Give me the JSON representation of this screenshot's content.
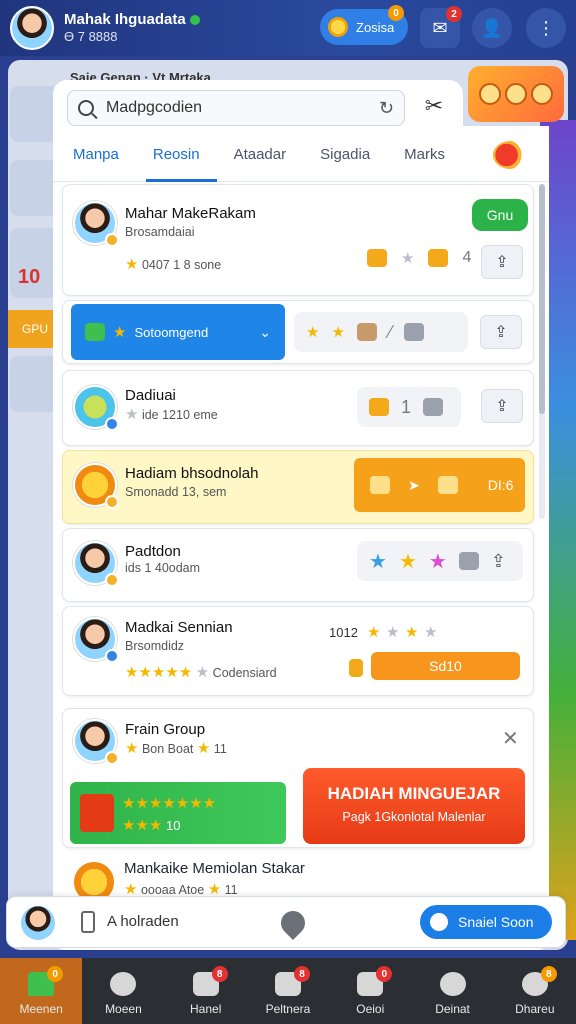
{
  "topbar": {
    "name": "Mahak Ihguadata",
    "id": "Ө 7 8888",
    "coin_label": "Zosisa",
    "coin_badge": "0",
    "inbox_badge": "2"
  },
  "background": {
    "title": "Saie Genan  ·  Vt   Mrtaka",
    "gpu_label": "GPU",
    "left_number": "10"
  },
  "search": {
    "value": "Madpgcodien"
  },
  "tabs": [
    {
      "label": "Manpa"
    },
    {
      "label": "Reosin",
      "active": true
    },
    {
      "label": "Ataadar"
    },
    {
      "label": "Sigadia"
    },
    {
      "label": "Marks"
    }
  ],
  "cards": {
    "c1": {
      "name": "Mahar MakeRakam",
      "sub": "Brosamdaiai",
      "meta": "0407 1 8 sone",
      "button": "Gnu"
    },
    "c2": {
      "select": "Sotoomgend"
    },
    "c3": {
      "name": "Dadiuai",
      "meta": "ide 1210 eme"
    },
    "c4": {
      "name": "Hadiam bhsodnolah",
      "sub": "Smonadd 13, sem",
      "button": "DI:6"
    },
    "c5": {
      "name": "Padtdon",
      "sub": "ids 1 40odam"
    },
    "c6": {
      "name": "Madkai Sennian",
      "sub": "Brsomdidz",
      "score": "1012",
      "meta": "Codensiard",
      "button": "Sd10"
    },
    "c7": {
      "name": "Frain Group",
      "meta": "Bon   Boat",
      "count": "11",
      "promo_count": "10",
      "promo_title": "HADIAH MINGUEJAR",
      "promo_sub": "Pagk 1Gkonlotal Malenlar"
    },
    "c8": {
      "name": "Mankaike Memiolan Stakar",
      "meta": "oooaa  Atoe",
      "count": "11"
    }
  },
  "inputbar": {
    "placeholder": "A holraden",
    "send_label": "Snaiel Soon"
  },
  "nav": [
    {
      "label": "Meenen",
      "badge": "0",
      "active": true
    },
    {
      "label": "Moeen",
      "badge": ""
    },
    {
      "label": "Hanel",
      "badge": "8"
    },
    {
      "label": "Peltnera",
      "badge": "8"
    },
    {
      "label": "Oeioi",
      "badge": "0"
    },
    {
      "label": "Deinat",
      "badge": ""
    },
    {
      "label": "Dhareu",
      "badge": "8"
    }
  ],
  "colors": {
    "accent": "#1a6ed8",
    "success": "#2bb34a",
    "warning": "#f6a11a",
    "danger": "#e53a16"
  }
}
